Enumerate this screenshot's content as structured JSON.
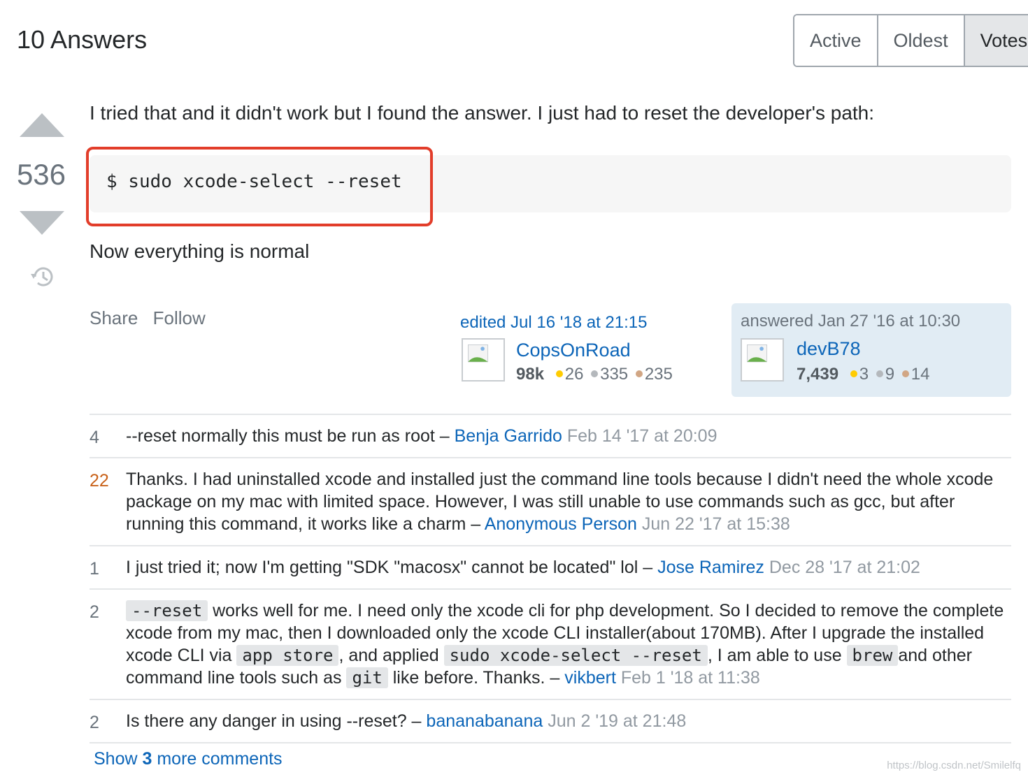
{
  "answers_header": {
    "title": "10 Answers",
    "sort_tabs": [
      {
        "label": "Active",
        "selected": false
      },
      {
        "label": "Oldest",
        "selected": false
      },
      {
        "label": "Votes",
        "selected": true
      }
    ]
  },
  "vote": {
    "count": "536",
    "up_icon": "arrow-up-icon",
    "down_icon": "arrow-down-icon",
    "history_icon": "history-icon"
  },
  "post": {
    "intro": "I tried that and it didn't work but I found the answer. I just had to reset the developer's path:",
    "code": "$ sudo xcode-select --reset",
    "after": "Now everything is normal",
    "menu": {
      "share": "Share",
      "follow": "Follow"
    }
  },
  "edited": {
    "action": "edited Jul 16 '18 at 21:15",
    "user": "CopsOnRoad",
    "rep": "98k",
    "gold": "26",
    "silver": "335",
    "bronze": "235"
  },
  "answered": {
    "action": "answered Jan 27 '16 at 10:30",
    "user": "devB78",
    "rep": "7,439",
    "gold": "3",
    "silver": "9",
    "bronze": "14"
  },
  "comments": [
    {
      "score": "4",
      "text": "--reset normally this must be run as root – ",
      "user": "Benja Garrido",
      "date": "Feb 14 '17 at 20:09"
    },
    {
      "score": "22",
      "text": "Thanks. I had uninstalled xcode and installed just the command line tools because I didn't need the whole xcode package on my mac with limited space. However, I was still unable to use commands such as gcc, but after running this command, it works like a charm – ",
      "user": "Anonymous Person",
      "date": "Jun 22 '17 at 15:38"
    },
    {
      "score": "1",
      "text": "I just tried it; now I'm getting \"SDK \"macosx\" cannot be located\" lol – ",
      "user": "Jose Ramirez",
      "date": "Dec 28 '17 at 21:02"
    },
    {
      "score": "2",
      "code1": "--reset",
      "text1": " works well for me. I need only the xcode cli for php development. So I decided to remove the complete xcode from my mac, then I downloaded only the xcode CLI installer(about 170MB). After I upgrade the installed xcode CLI via ",
      "code2": "app store",
      "text2": ", and applied ",
      "code3": "sudo xcode-select --reset",
      "text3": ", I am able to use ",
      "code4": "brew",
      "text4": "and other command line tools such as ",
      "code5": "git",
      "text5": " like before. Thanks. – ",
      "user": "vikbert",
      "date": "Feb 1 '18 at 11:38"
    },
    {
      "score": "2",
      "text": "Is there any danger in using --reset? – ",
      "user": "bananabanana",
      "date": "Jun 2 '19 at 21:48"
    }
  ],
  "show_more": {
    "prefix": "Show ",
    "count": "3",
    "suffix": " more comments"
  },
  "watermark": "https://blog.csdn.net/Smilelfq"
}
